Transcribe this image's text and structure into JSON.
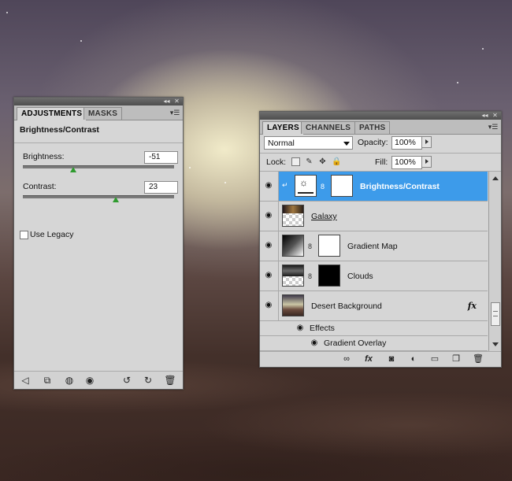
{
  "adjustments_panel": {
    "tabs": [
      "ADJUSTMENTS",
      "MASKS"
    ],
    "title": "Brightness/Contrast",
    "brightness": {
      "label": "Brightness:",
      "value": "-51"
    },
    "contrast": {
      "label": "Contrast:",
      "value": "23"
    },
    "use_legacy": {
      "label": "Use Legacy",
      "checked": false
    },
    "footer_icons": [
      "back-arrow-icon",
      "clip-layer-icon",
      "mask-icon",
      "eye-icon",
      "view-previous-icon",
      "reset-icon",
      "trash-icon"
    ]
  },
  "layers_panel": {
    "tabs": [
      "LAYERS",
      "CHANNELS",
      "PATHS"
    ],
    "blend_mode": "Normal",
    "opacity": {
      "label": "Opacity:",
      "value": "100%"
    },
    "lock_label": "Lock:",
    "fill": {
      "label": "Fill:",
      "value": "100%"
    },
    "layers": [
      {
        "name": "Brightness/Contrast",
        "selected": true,
        "type": "adjustment"
      },
      {
        "name": "Galaxy",
        "selected": false,
        "type": "image"
      },
      {
        "name": "Gradient Map",
        "selected": false,
        "type": "adjustment"
      },
      {
        "name": "Clouds",
        "selected": false,
        "type": "masked"
      },
      {
        "name": "Desert Background",
        "selected": false,
        "type": "image",
        "fx": "fx"
      }
    ],
    "effects_label": "Effects",
    "effect_item": "Gradient Overlay",
    "footer_icons": [
      "link-icon",
      "fx-icon",
      "add-mask-icon",
      "new-adjustment-icon",
      "new-group-icon",
      "new-layer-icon",
      "trash-icon"
    ]
  },
  "colors": {
    "selection": "#3d9bea",
    "slider_thumb": "#2f9b2f"
  }
}
